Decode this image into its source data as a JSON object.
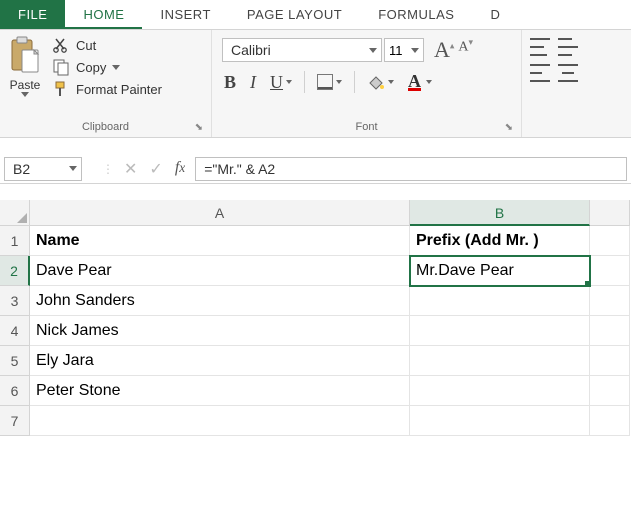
{
  "tabs": {
    "file": "FILE",
    "home": "HOME",
    "insert": "INSERT",
    "page_layout": "PAGE LAYOUT",
    "formulas": "FORMULAS",
    "d": "D"
  },
  "ribbon": {
    "clipboard": {
      "paste": "Paste",
      "cut": "Cut",
      "copy": "Copy",
      "format_painter": "Format Painter",
      "label": "Clipboard"
    },
    "font": {
      "name": "Calibri",
      "size": "11",
      "bold": "B",
      "italic": "I",
      "underline": "U",
      "label": "Font"
    }
  },
  "formula_bar": {
    "name_box": "B2",
    "formula": "=\"Mr.\" & A2"
  },
  "grid": {
    "columns": [
      "A",
      "B"
    ],
    "rows": [
      {
        "num": "1",
        "A": "Name",
        "B": "Prefix (Add Mr. )"
      },
      {
        "num": "2",
        "A": "Dave Pear",
        "B": "Mr.Dave Pear"
      },
      {
        "num": "3",
        "A": "John Sanders",
        "B": ""
      },
      {
        "num": "4",
        "A": "Nick James",
        "B": ""
      },
      {
        "num": "5",
        "A": "Ely Jara",
        "B": ""
      },
      {
        "num": "6",
        "A": "Peter Stone",
        "B": ""
      },
      {
        "num": "7",
        "A": "",
        "B": ""
      }
    ],
    "selected": {
      "row": 2,
      "col": "B"
    }
  },
  "chart_data": {
    "type": "table",
    "title": "",
    "columns": [
      "Name",
      "Prefix (Add Mr. )"
    ],
    "rows": [
      [
        "Dave Pear",
        "Mr.Dave Pear"
      ],
      [
        "John Sanders",
        ""
      ],
      [
        "Nick James",
        ""
      ],
      [
        "Ely Jara",
        ""
      ],
      [
        "Peter Stone",
        ""
      ]
    ]
  }
}
